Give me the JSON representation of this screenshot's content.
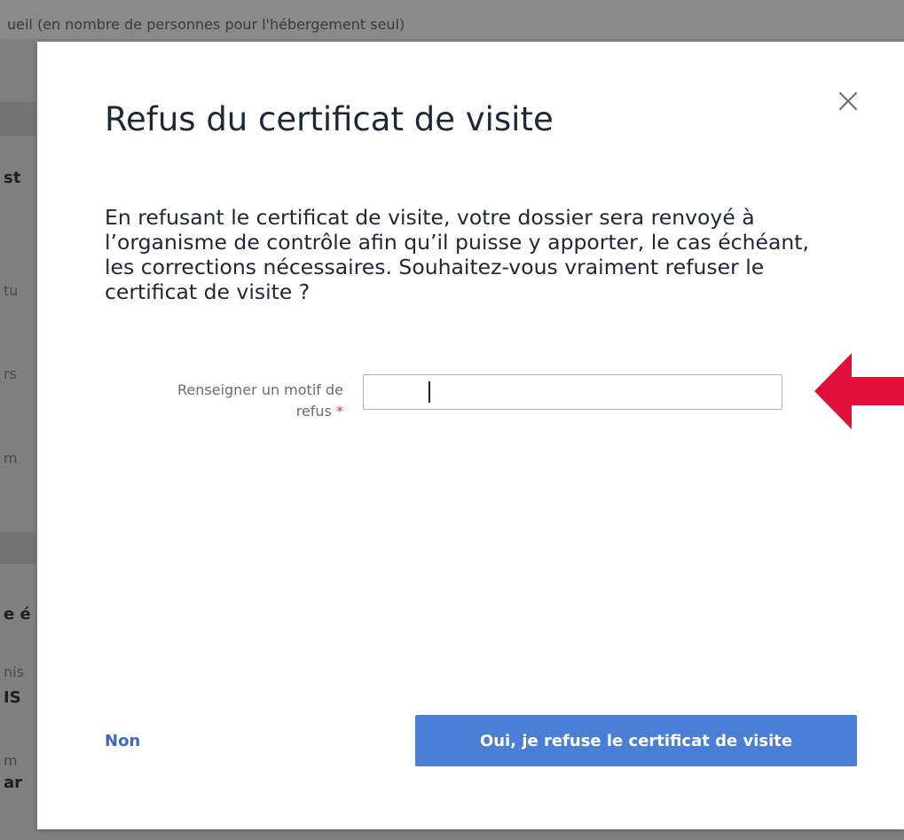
{
  "background": {
    "top_text": "ueil (en nombre de personnes pour l'hébergement seul)",
    "fragments": [
      "st",
      "tu",
      "rs",
      "m",
      "e é",
      "nis",
      "IS",
      "m",
      "ar"
    ]
  },
  "modal": {
    "title": "Refus du certificat de visite",
    "body": "En refusant le certificat de visite, votre dossier sera renvoyé à l’organisme de contrôle afin qu’il puisse y apporter, le cas échéant, les corrections nécessaires. Souhaitez-vous vraiment refuser le certificat de visite ?",
    "field": {
      "label_line1": "Renseigner un motif de",
      "label_line2": "refus",
      "required_marker": "*",
      "value": "",
      "placeholder": ""
    },
    "buttons": {
      "cancel_label": "Non",
      "confirm_label": "Oui, je refuse le certificat de visite"
    },
    "close_icon": "close-icon"
  },
  "annotation": {
    "arrow_icon": "red-arrow-left-icon",
    "arrow_color": "#e0103a"
  },
  "colors": {
    "primary_button": "#4a7fd6",
    "link": "#3d6ab3",
    "required": "#d9303a",
    "overlay": "#808080"
  }
}
